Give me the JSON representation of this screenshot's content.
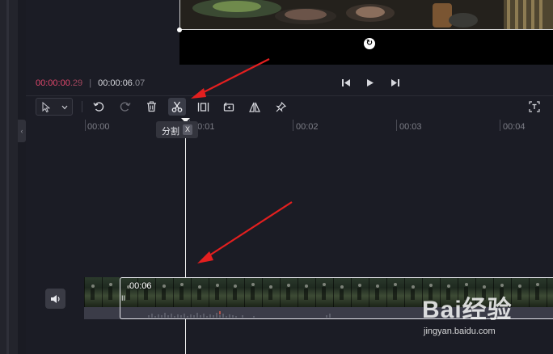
{
  "preview": {
    "rotate_icon": "rotate-icon"
  },
  "timecode": {
    "current_main": "00:00:00",
    "current_frames": ".29",
    "separator": "|",
    "total_main": "00:00:06",
    "total_frames": ".07"
  },
  "playback": {
    "prev_icon": "skip-back-icon",
    "play_icon": "play-icon",
    "next_icon": "skip-forward-icon"
  },
  "toolbar": {
    "tools": [
      "select-pointer",
      "undo",
      "redo",
      "delete",
      "split",
      "freeze",
      "reverse",
      "mirror",
      "pin",
      "text-recognize"
    ]
  },
  "ruler": {
    "labels": [
      "00:00",
      "00:01",
      "00:02",
      "00:03",
      "00:04"
    ]
  },
  "tooltip": {
    "label": "分割",
    "shortcut": "X"
  },
  "track": {
    "clip_duration": "00:06",
    "clip_grip": "II"
  },
  "watermark": {
    "brand": "Bai经验",
    "url": "jingyan.baidu.com"
  },
  "colors": {
    "background": "#1b1c25",
    "accent_timecode": "#e0476c",
    "annotation_arrow": "#e31f1f"
  }
}
